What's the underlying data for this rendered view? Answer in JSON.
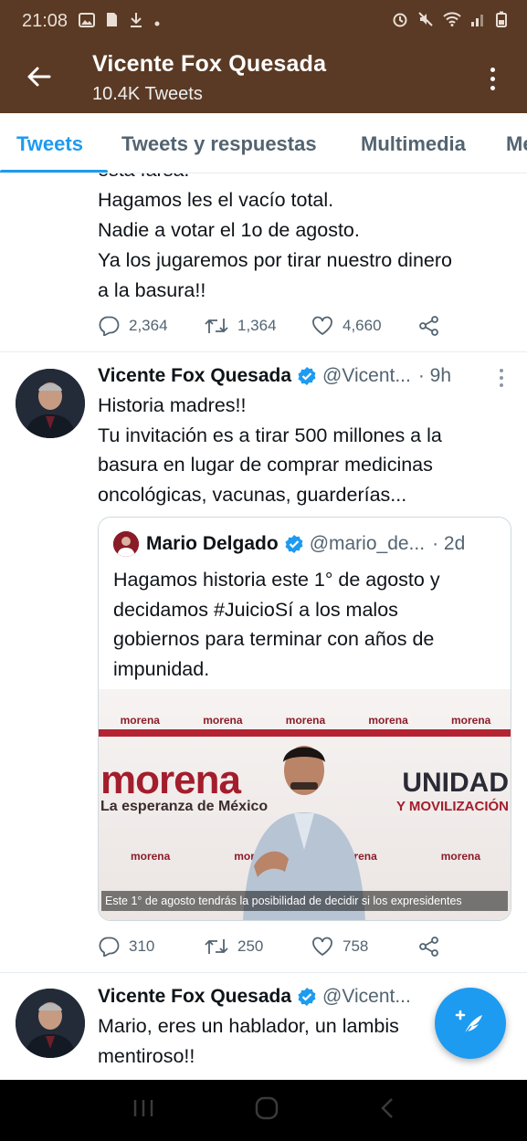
{
  "status_bar": {
    "time": "21:08"
  },
  "app_bar": {
    "title": "Vicente Fox Quesada",
    "subtitle": "10.4K Tweets"
  },
  "tabs": [
    {
      "label": "Tweets"
    },
    {
      "label": "Tweets y respuestas"
    },
    {
      "label": "Multimedia"
    },
    {
      "label": "Me"
    }
  ],
  "tweet1": {
    "partial_line": "esta farsa.",
    "lines": [
      "Hagamos les el vacío total.",
      "Nadie a votar el 1o de agosto.",
      "Ya los jugaremos por tirar nuestro dinero",
      "a la basura!!"
    ],
    "replies": "2,364",
    "retweets": "1,364",
    "likes": "4,660"
  },
  "tweet2": {
    "name": "Vicente Fox Quesada",
    "handle": "@Vicent...",
    "time": "· 9h",
    "lines": [
      "Historia madres!!",
      "Tu invitación es a tirar 500 millones a la",
      "basura en lugar de comprar medicinas",
      "oncológicas, vacunas, guarderías..."
    ],
    "replies": "310",
    "retweets": "250",
    "likes": "758",
    "quote": {
      "name": "Mario Delgado",
      "handle": "@mario_de...",
      "time": "· 2d",
      "lines": [
        "Hagamos historia este 1° de agosto y",
        "decidamos #JuicioSí a los malos",
        "gobiernos para terminar con años de",
        "impunidad."
      ],
      "media": {
        "wall_label": "morena",
        "logo": "morena",
        "tagline": "La esperanza de México",
        "slogan_1": "UNIDAD",
        "slogan_2": "Y MOVILIZACIÓN",
        "caption": "Este 1° de agosto tendrás la posibilidad de decidir si los expresidentes"
      }
    }
  },
  "tweet3": {
    "name": "Vicente Fox Quesada",
    "handle": "@Vicent...",
    "lines": [
      "Mario, eres un hablador, un lambis",
      "mentiroso!!"
    ]
  },
  "colors": {
    "app_bar": "#5a3a24",
    "accent": "#1d9bf0",
    "secondary_text": "#536471"
  }
}
